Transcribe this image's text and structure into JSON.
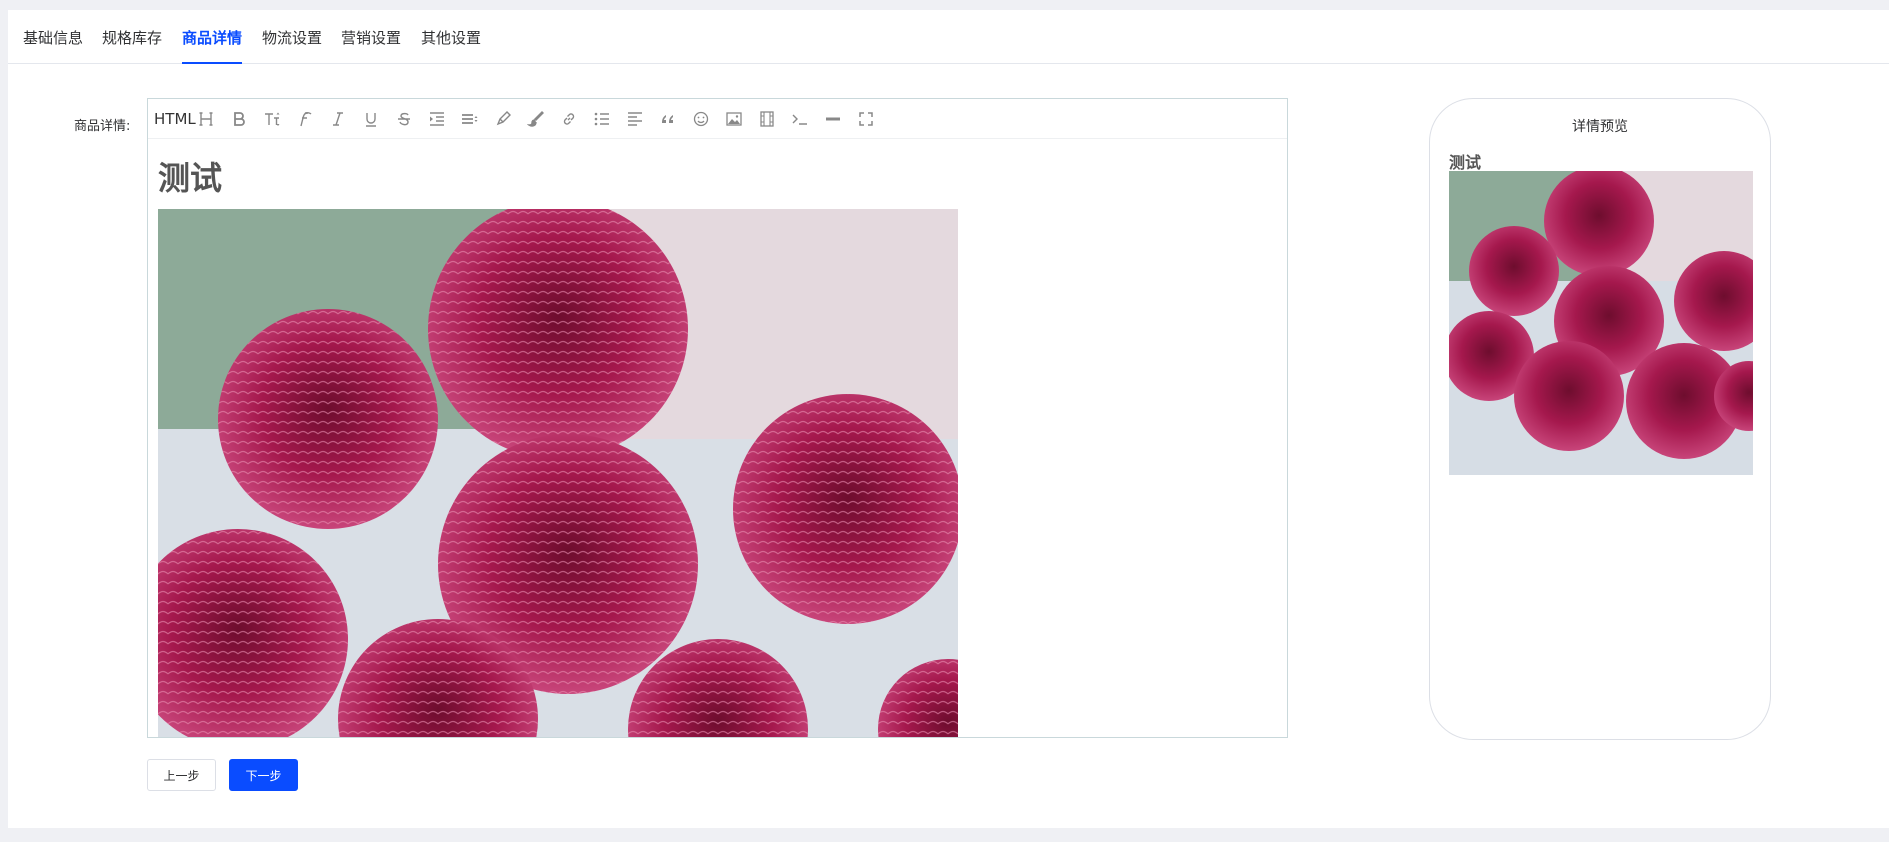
{
  "tabs": [
    {
      "label": "基础信息",
      "active": false
    },
    {
      "label": "规格库存",
      "active": false
    },
    {
      "label": "商品详情",
      "active": true
    },
    {
      "label": "物流设置",
      "active": false
    },
    {
      "label": "营销设置",
      "active": false
    },
    {
      "label": "其他设置",
      "active": false
    }
  ],
  "form": {
    "field_label": "商品详情:"
  },
  "editor": {
    "html_label": "HTML",
    "toolbar_icons": [
      "heading-icon",
      "bold-icon",
      "font-size-icon",
      "font-family-icon",
      "italic-icon",
      "underline-icon",
      "strikethrough-icon",
      "indent-icon",
      "line-height-icon",
      "fore-color-icon",
      "back-color-icon",
      "link-icon",
      "bulleted-list-icon",
      "align-icon",
      "quote-icon",
      "emoticon-icon",
      "image-icon",
      "video-icon",
      "code-icon",
      "divider-icon",
      "fullscreen-icon"
    ],
    "content_title": "测试",
    "content_image": "flower-photo"
  },
  "actions": {
    "prev_label": "上一步",
    "next_label": "下一步"
  },
  "preview": {
    "title": "详情预览",
    "content_title": "测试",
    "content_image": "flower-photo"
  },
  "colors": {
    "accent": "#0a4cff",
    "page_bg": "#eff0f4"
  }
}
